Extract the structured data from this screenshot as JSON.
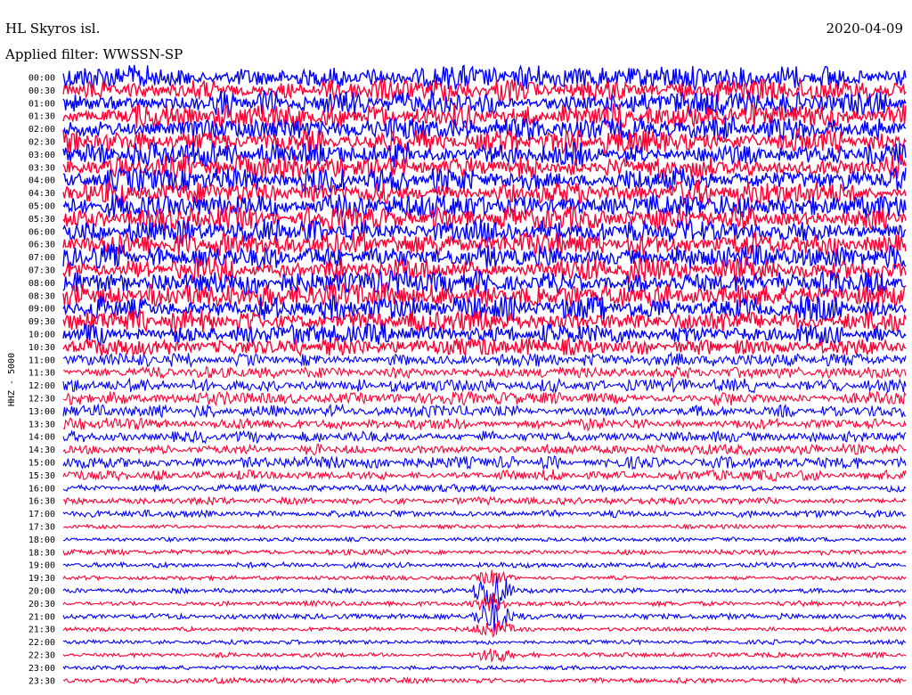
{
  "header": {
    "station": "HL Skyros isl.",
    "date": "2020-04-09",
    "filter": "Applied filter: WWSSN-SP"
  },
  "chart_data": {
    "type": "line",
    "plot_kind": "helicorder",
    "ylabel": "HHZ - 5000",
    "rows": [
      "00:00",
      "00:30",
      "01:00",
      "01:30",
      "02:00",
      "02:30",
      "03:00",
      "03:30",
      "04:00",
      "04:30",
      "05:00",
      "05:30",
      "06:00",
      "06:30",
      "07:00",
      "07:30",
      "08:00",
      "08:30",
      "09:00",
      "09:30",
      "10:00",
      "10:30",
      "11:00",
      "11:30",
      "12:00",
      "12:30",
      "13:00",
      "13:30",
      "14:00",
      "14:30",
      "15:00",
      "15:30",
      "16:00",
      "16:30",
      "17:00",
      "17:30",
      "18:00",
      "18:30",
      "19:00",
      "19:30",
      "20:00",
      "20:30",
      "21:00",
      "21:30",
      "22:00",
      "22:30",
      "23:00",
      "23:30"
    ],
    "trace_colors": [
      "#0000ff",
      "#ff0033"
    ],
    "noise_level": [
      1.0,
      1.0,
      1.0,
      1.0,
      1.0,
      1.0,
      1.0,
      1.0,
      1.0,
      1.0,
      1.0,
      1.0,
      1.0,
      1.0,
      1.0,
      1.0,
      1.0,
      1.0,
      1.0,
      0.95,
      0.85,
      0.7,
      0.55,
      0.5,
      0.55,
      0.55,
      0.5,
      0.5,
      0.5,
      0.45,
      0.5,
      0.45,
      0.3,
      0.22,
      0.2,
      0.1,
      0.1,
      0.14,
      0.14,
      0.1,
      0.12,
      0.14,
      0.16,
      0.12,
      0.12,
      0.12,
      0.1,
      0.14
    ],
    "event": {
      "row": "20:00",
      "x_fraction": 0.51,
      "note": "large earthquake signal"
    }
  }
}
